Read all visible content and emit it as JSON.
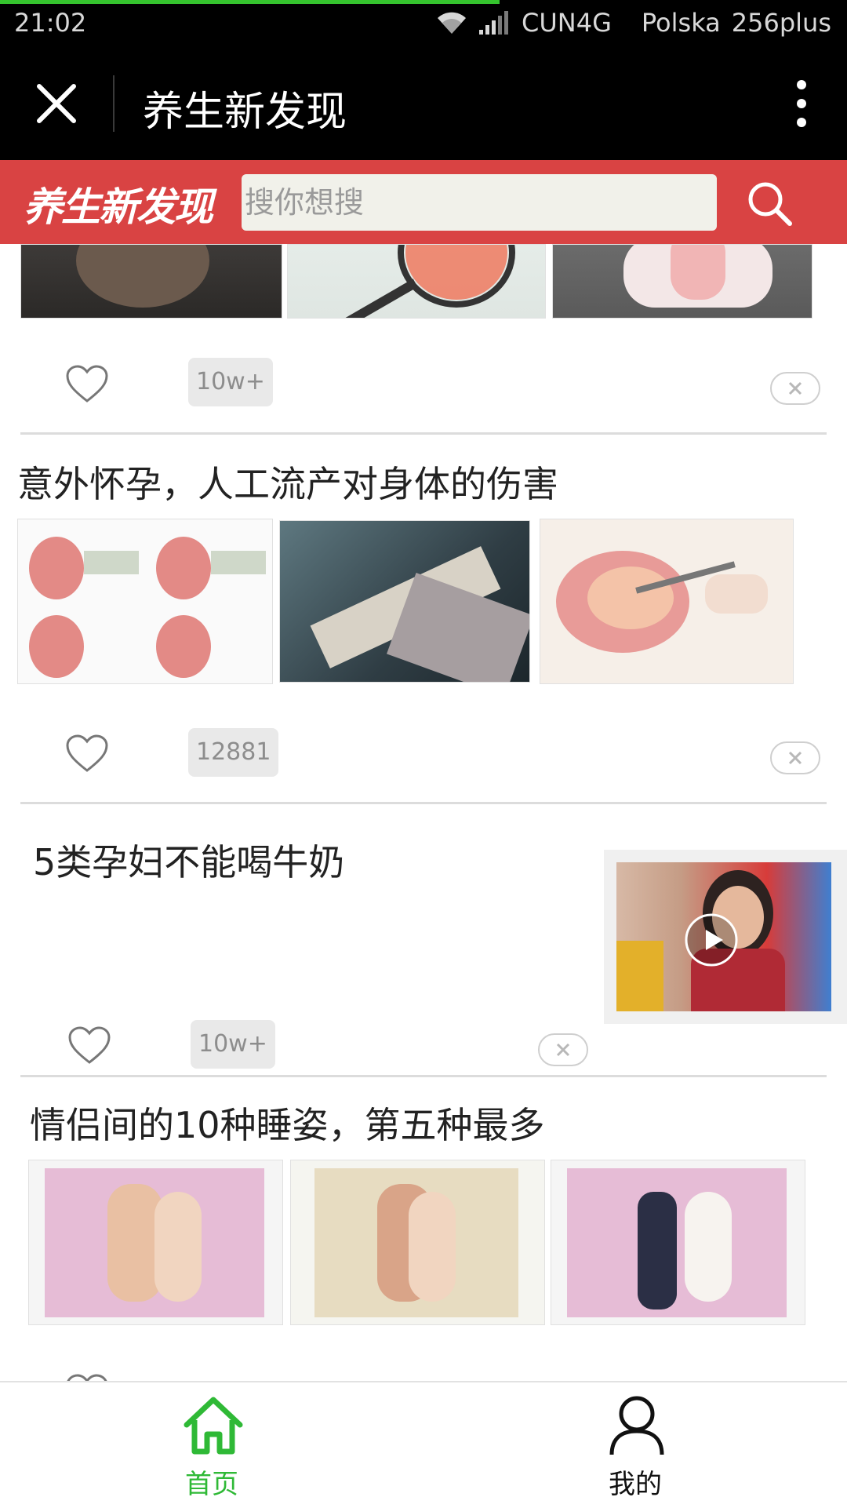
{
  "status_bar": {
    "time": "21:02",
    "carrier": "CUN4G",
    "operator": "Polska",
    "device": "256plus",
    "icons": [
      "wifi-icon",
      "signal-icon"
    ],
    "page_load_progress": 0.59
  },
  "title_bar": {
    "title": "养生新发现",
    "close_icon": "close-icon",
    "more_icon": "more-vertical-icon"
  },
  "search_bar": {
    "brand": "养生新发现",
    "placeholder": "搜你想搜",
    "search_icon": "search-icon"
  },
  "feed": {
    "items": [
      {
        "title": "",
        "count": "10w+"
      },
      {
        "title": "意外怀孕，人工流产对身体的伤害",
        "count": "12881"
      },
      {
        "title": "5类孕妇不能喝牛奶",
        "count": "10w+",
        "has_video": true
      },
      {
        "title": "情侣间的10种睡姿，第五种最多",
        "count": ""
      }
    ],
    "accent_colors": {
      "header_red": "#d94343",
      "tab_active_green": "#2fb936"
    }
  },
  "tab_bar": {
    "tabs": [
      {
        "label": "首页",
        "icon": "home-icon",
        "active": true
      },
      {
        "label": "我的",
        "icon": "user-icon",
        "active": false
      }
    ]
  }
}
